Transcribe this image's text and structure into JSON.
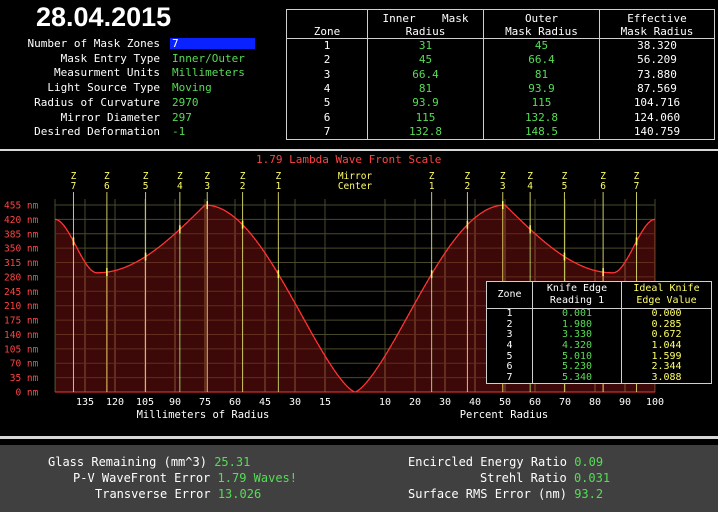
{
  "date": "28.04.2015",
  "params": [
    {
      "label": "Number of Mask Zones",
      "value": "7"
    },
    {
      "label": "Mask Entry Type",
      "value": "Inner/Outer"
    },
    {
      "label": "Measurment Units",
      "value": "Millimeters"
    },
    {
      "label": "Light Source Type",
      "value": "Moving"
    },
    {
      "label": "Radius of Curvature",
      "value": "2970"
    },
    {
      "label": "Mirror Diameter",
      "value": "297"
    },
    {
      "label": "Desired Deformation",
      "value": "-1"
    }
  ],
  "zone_table": {
    "headers": [
      "Zone",
      "Inner    Mask\nRadius",
      "Outer\nMask Radius",
      "Effective\nMask Radius"
    ],
    "rows": [
      [
        "1",
        "31",
        "45",
        "38.320"
      ],
      [
        "2",
        "45",
        "66.4",
        "56.209"
      ],
      [
        "3",
        "66.4",
        "81",
        "73.880"
      ],
      [
        "4",
        "81",
        "93.9",
        "87.569"
      ],
      [
        "5",
        "93.9",
        "115",
        "104.716"
      ],
      [
        "6",
        "115",
        "132.8",
        "124.060"
      ],
      [
        "7",
        "132.8",
        "148.5",
        "140.759"
      ]
    ]
  },
  "chart_data": {
    "type": "line",
    "title": "1.79 Lambda Wave Front Scale",
    "y_unit": "nm",
    "y_ticks": [
      0,
      35,
      70,
      105,
      140,
      175,
      210,
      245,
      280,
      315,
      350,
      385,
      420,
      455
    ],
    "ylim": [
      0,
      455
    ],
    "left_xlabel": "Millimeters of Radius",
    "left_x_ticks": [
      "135",
      "120",
      "105",
      "90",
      "75",
      "60",
      "45",
      "30",
      "15"
    ],
    "right_xlabel": "Percent Radius",
    "right_x_ticks": [
      "10",
      "20",
      "30",
      "40",
      "50",
      "60",
      "70",
      "80",
      "90",
      "100"
    ],
    "center_label": [
      "Mirror",
      "Center"
    ],
    "zone_markers": [
      "Z7",
      "Z6",
      "Z5",
      "Z4",
      "Z3",
      "Z2",
      "Z1",
      "Z1",
      "Z2",
      "Z3",
      "Z4",
      "Z5",
      "Z6",
      "Z7"
    ],
    "grid": true,
    "line_color": "#ff3333"
  },
  "knife_table": {
    "headers": [
      "Zone",
      "Knife Edge\nReading 1",
      "Ideal Knife\nEdge Value"
    ],
    "rows": [
      [
        "1",
        "0.001",
        "0.000"
      ],
      [
        "2",
        "1.980",
        "0.285"
      ],
      [
        "3",
        "3.330",
        "0.672"
      ],
      [
        "4",
        "4.320",
        "1.044"
      ],
      [
        "5",
        "5.010",
        "1.599"
      ],
      [
        "6",
        "5.230",
        "2.344"
      ],
      [
        "7",
        "5.340",
        "3.088"
      ]
    ]
  },
  "bottom": {
    "glass_label": "Glass Remaining (mm^3)",
    "glass_value": "25.31",
    "pv_label": "P-V WaveFront Error",
    "pv_value": "1.79 Waves!",
    "transverse_label": "Transverse Error",
    "transverse_value": "13.026",
    "energy_label": "Encircled Energy Ratio",
    "energy_value": "0.09",
    "strehl_label": "Strehl Ratio",
    "strehl_value": "0.031",
    "rms_label": "Surface RMS Error (nm)",
    "rms_value": "93.2"
  },
  "colors": {
    "accent_green": "#55dd55",
    "input_blue": "#0a22ff",
    "curve_red": "#ff3333",
    "marker_yellow": "#ffff66"
  }
}
